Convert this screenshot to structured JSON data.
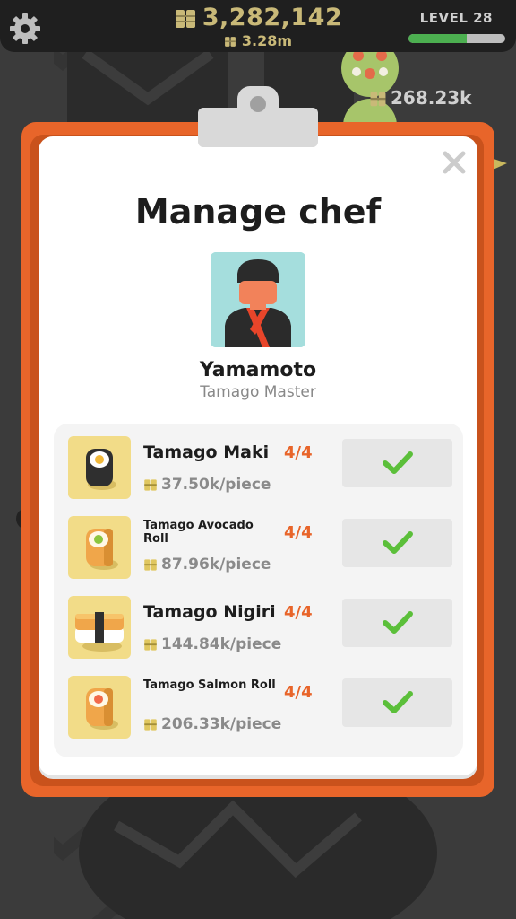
{
  "hud": {
    "coins": "3,282,142",
    "coins_rate": "3.28m",
    "level": "LEVEL 28",
    "xp_progress": 0.6,
    "conveyor_rate": "268.23k"
  },
  "dialog": {
    "title": "Manage chef",
    "chef": {
      "name": "Yamamoto",
      "role": "Tamago Master"
    },
    "recipes": [
      {
        "name": "Tamago Maki",
        "count": "4/4",
        "price": "37.50k/piece",
        "icon": "tamago-maki-icon",
        "name_size": "big"
      },
      {
        "name": "Tamago Avocado Roll",
        "count": "4/4",
        "price": "87.96k/piece",
        "icon": "tamago-avocado-roll-icon",
        "name_size": "small"
      },
      {
        "name": "Tamago Nigiri",
        "count": "4/4",
        "price": "144.84k/piece",
        "icon": "tamago-nigiri-icon",
        "name_size": "big"
      },
      {
        "name": "Tamago Salmon Roll",
        "count": "4/4",
        "price": "206.33k/piece",
        "icon": "tamago-salmon-roll-icon",
        "name_size": "small"
      }
    ]
  },
  "colors": {
    "accent_orange": "#e8652a",
    "check_green": "#5bbf3a",
    "coin_gold": "#c9b978",
    "xp_green": "#4caf50"
  }
}
